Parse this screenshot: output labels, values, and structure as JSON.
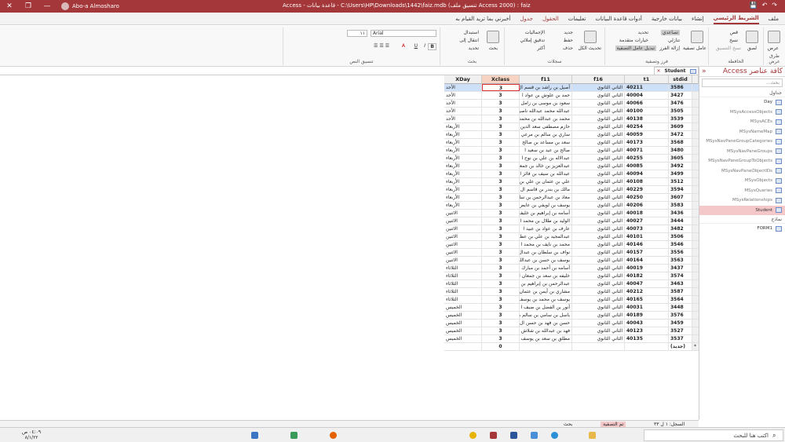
{
  "titlebar": {
    "title": "Access - قاعدة بيانات - C:\\Users\\HP\\Downloads\\1442\\faiz.mdb (تنسيق ملف Access 2000) : faiz",
    "user": "Abo-a Almosharo"
  },
  "tabs": [
    {
      "label": "ملف"
    },
    {
      "label": "الشريط الرئيسي"
    },
    {
      "label": "إنشاء"
    },
    {
      "label": "بيانات خارجية"
    },
    {
      "label": "أدوات قاعدة البيانات"
    },
    {
      "label": "تعليمات"
    },
    {
      "label": "الحقول"
    },
    {
      "label": "جدول"
    },
    {
      "label": "أخبرني بما تريد القيام به"
    }
  ],
  "ribbon": {
    "groups": [
      {
        "label": "طرق عرض"
      },
      {
        "label": "الحافظة"
      },
      {
        "label": "فرز وتصفية"
      },
      {
        "label": "سجلات"
      },
      {
        "label": "بحث"
      },
      {
        "label": "تنسيق النص"
      }
    ],
    "view_btn": "عرض",
    "paste_btn": "لصق",
    "cut": "قص",
    "copy": "نسخ",
    "format_painter": "نسخ التنسيق",
    "filter_btn": "عامل تصفية",
    "ascending": "تصاعدي",
    "descending": "تنازلي",
    "remove_sort": "إزالة الفرز",
    "selection": "تحديد",
    "advanced": "خيارات متقدمة",
    "toggle_filter": "تبديل عامل التصفية",
    "refresh_all": "تحديث الكل",
    "new": "جديد",
    "save": "حفظ",
    "delete": "حذف",
    "totals": "الإجماليات",
    "spelling": "تدقيق إملائي",
    "more": "أكثر",
    "find_btn": "بحث",
    "replace": "استبدال",
    "goto": "انتقال إلى",
    "select": "تحديد",
    "font": "Arial",
    "font_size": "١١"
  },
  "nav": {
    "title": "كافة عناصر Access",
    "search_placeholder": "بحث...",
    "tables_label": "جداول",
    "forms_label": "نماذج",
    "tables": [
      {
        "name": "Day",
        "state": "vis"
      },
      {
        "name": "MSysAccessObjects",
        "state": ""
      },
      {
        "name": "MSysACEs",
        "state": ""
      },
      {
        "name": "MSysNameMap",
        "state": ""
      },
      {
        "name": "MSysNavPaneGroupCategories",
        "state": ""
      },
      {
        "name": "MSysNavPaneGroups",
        "state": ""
      },
      {
        "name": "MSysNavPaneGroupToObjects",
        "state": ""
      },
      {
        "name": "MSysNavPaneObjectIDs",
        "state": ""
      },
      {
        "name": "MSysObjects",
        "state": ""
      },
      {
        "name": "MSysQueries",
        "state": ""
      },
      {
        "name": "MSysRelationships",
        "state": ""
      },
      {
        "name": "Student",
        "state": "sel"
      }
    ],
    "forms": [
      {
        "name": "FORM1"
      }
    ]
  },
  "doc_tab": "Student",
  "table": {
    "columns": [
      "XDay",
      "Xclass",
      "f11",
      "f16",
      "t1",
      "stdid"
    ],
    "rows": [
      [
        "الأحد",
        "3",
        "أصيل بن راشد بن قسم ال",
        "الثاني الثانوي",
        "40211",
        "3586"
      ],
      [
        "الأحد",
        "3",
        "حمد بن علوش بن عواد ا",
        "الثاني الثانوي",
        "40004",
        "3427"
      ],
      [
        "الأحد",
        "3",
        "سعود بن موسى بن زامل ا",
        "الثاني الثانوي",
        "40066",
        "3476"
      ],
      [
        "الأحد",
        "3",
        "عبدالله محمد عبدالله ناصر",
        "الثاني الثانوي",
        "40100",
        "3505"
      ],
      [
        "الأحد",
        "3",
        "محمد بن عبدالله بن محمد ا",
        "الثاني الثانوي",
        "40138",
        "3539"
      ],
      [
        "الأربعاء",
        "3",
        "حازم مصطفى سعد الدين",
        "الثاني الثانوي",
        "40254",
        "3609"
      ],
      [
        "الأربعاء",
        "3",
        "ساري بن سالم بن مرعي",
        "الثاني الثانوي",
        "40059",
        "3472"
      ],
      [
        "الأربعاء",
        "3",
        "سعد بن مساعد بن صالح",
        "الثاني الثانوي",
        "40173",
        "3568"
      ],
      [
        "الأربعاء",
        "3",
        "صالح بن عيد بن سعيد ا",
        "الثاني الثانوي",
        "40071",
        "3480"
      ],
      [
        "الأربعاء",
        "3",
        "عبدالاله بن علي بن نوح ا",
        "الثاني الثانوي",
        "40255",
        "3605"
      ],
      [
        "الأربعاء",
        "3",
        "عبدالعزيز بن خالد بن جمعة",
        "الثاني الثانوي",
        "40085",
        "3492"
      ],
      [
        "الأربعاء",
        "3",
        "عبدالله بن سيف بن فائز ا",
        "الثاني الثانوي",
        "40094",
        "3499"
      ],
      [
        "الأربعاء",
        "3",
        "علي بن عثمان بن علي بن",
        "الثاني الثانوي",
        "40108",
        "3512"
      ],
      [
        "الأربعاء",
        "3",
        "مالك بن بندر بن قاسم ال",
        "الثاني الثانوي",
        "40229",
        "3594"
      ],
      [
        "الأربعاء",
        "3",
        "معاذ بن عبدالرحمن بن سا",
        "الثاني الثانوي",
        "40250",
        "3607"
      ],
      [
        "الأربعاء",
        "3",
        "يوسف بن لويفي بن عايض",
        "الثاني الثانوي",
        "40206",
        "3583"
      ],
      [
        "الاثنين",
        "3",
        "أسامه بن إبراهيم بن خليف",
        "الثاني الثانوي",
        "40018",
        "3436"
      ],
      [
        "الاثنين",
        "3",
        "الوليد بن طلال بن محمد ا",
        "الثاني الثانوي",
        "40027",
        "3444"
      ],
      [
        "الاثنين",
        "3",
        "عارف بن عواد بن عبيد ا",
        "الثاني الثانوي",
        "40073",
        "3482"
      ],
      [
        "الاثنين",
        "3",
        "عبدالمجيد بن علي بن عط",
        "الثاني الثانوي",
        "40101",
        "3506"
      ],
      [
        "الاثنين",
        "3",
        "محمد بن نايف بن محمد ا",
        "الثاني الثانوي",
        "40146",
        "3546"
      ],
      [
        "الاثنين",
        "3",
        "نواف بن سلطان بن عبدال",
        "الثاني الثانوي",
        "40157",
        "3556"
      ],
      [
        "الاثنين",
        "3",
        "يوسف بن حسن بن عبدالله",
        "الثاني الثانوي",
        "40164",
        "3563"
      ],
      [
        "الثلاثاء",
        "3",
        "أسامه بن أحمد بن مبارك",
        "الثاني الثانوي",
        "40019",
        "3437"
      ],
      [
        "الثلاثاء",
        "3",
        "خليفه بن سعد بن جمعان ا",
        "الثاني الثانوي",
        "40182",
        "3574"
      ],
      [
        "الثلاثاء",
        "3",
        "عبدالرحمن بن إبراهيم بن",
        "الثاني الثانوي",
        "40047",
        "3463"
      ],
      [
        "الثلاثاء",
        "3",
        "مشاري بن أيمن بن عثمان",
        "الثاني الثانوي",
        "40212",
        "3587"
      ],
      [
        "الثلاثاء",
        "3",
        "يوسف بن محمد بن يوسف",
        "الثاني الثانوي",
        "40165",
        "3564"
      ],
      [
        "الخميس",
        "3",
        "أنور بن الفضل بن ضيف ا",
        "الثاني الثانوي",
        "40031",
        "3448"
      ],
      [
        "الخميس",
        "3",
        "باسل بن سامي بن سالم م",
        "الثاني الثانوي",
        "40189",
        "3576"
      ],
      [
        "الخميس",
        "3",
        "حسن بن فهد بن حسن ال",
        "الثاني الثانوي",
        "40043",
        "3459"
      ],
      [
        "الخميس",
        "3",
        "فهد بن عبدالله بن شلاش ا",
        "الثاني الثانوي",
        "40123",
        "3527"
      ],
      [
        "الخميس",
        "3",
        "مطلق بن سعد بن يوسف ا",
        "الثاني الثانوي",
        "40135",
        "3537"
      ],
      [
        "",
        "0",
        "",
        "",
        "",
        "(جديد)"
      ]
    ]
  },
  "record_nav": {
    "record": "السجل: ١ ل ٣٣",
    "filter": "تم التصفية",
    "search": "بحث"
  },
  "taskbar": {
    "search_placeholder": "اكتب هنا للبحث",
    "time": "٠٤:٠٩ ص",
    "date": "٨/١/٢٢"
  }
}
